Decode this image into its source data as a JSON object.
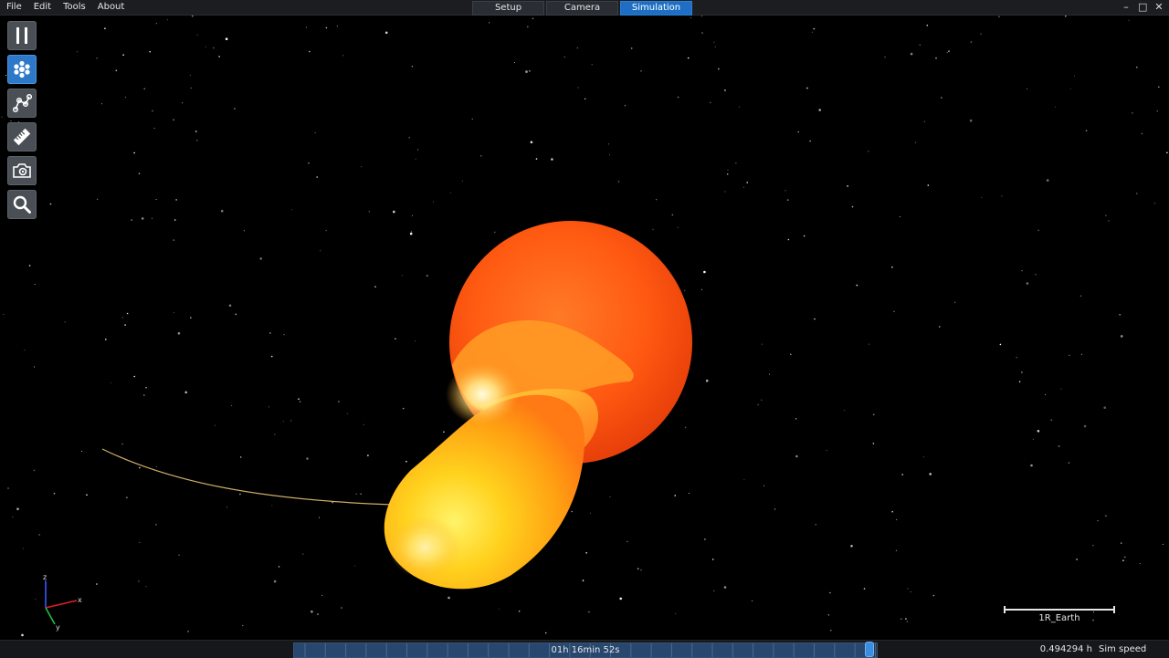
{
  "menu": [
    "File",
    "Edit",
    "Tools",
    "About"
  ],
  "tabs": [
    {
      "label": "Setup",
      "active": false
    },
    {
      "label": "Camera",
      "active": false
    },
    {
      "label": "Simulation",
      "active": true
    }
  ],
  "window_controls": {
    "minimize": "–",
    "maximize": "□",
    "close": "✕"
  },
  "toolbar": [
    {
      "name": "pause-button",
      "icon": "pause-icon",
      "active": false
    },
    {
      "name": "particles-button",
      "icon": "particles-icon",
      "active": true
    },
    {
      "name": "trajectory-button",
      "icon": "trajectory-icon",
      "active": false
    },
    {
      "name": "ruler-button",
      "icon": "ruler-icon",
      "active": false
    },
    {
      "name": "render-settings-button",
      "icon": "camera-gear-icon",
      "active": false
    },
    {
      "name": "zoom-button",
      "icon": "search-icon",
      "active": false
    }
  ],
  "axis_gizmo": {
    "z": "z",
    "x": "x",
    "y": "y"
  },
  "scale_bar": {
    "label": "1R_Earth"
  },
  "timeline": {
    "label": "01h 16min 52s",
    "progress": 0.99
  },
  "status": {
    "sim_time": "0.494294 h",
    "sim_speed_label": "Sim speed"
  },
  "colors": {
    "accent": "#1e6fc3",
    "star_primary": "#ff5a10",
    "star_secondary": "#ffc21a"
  }
}
